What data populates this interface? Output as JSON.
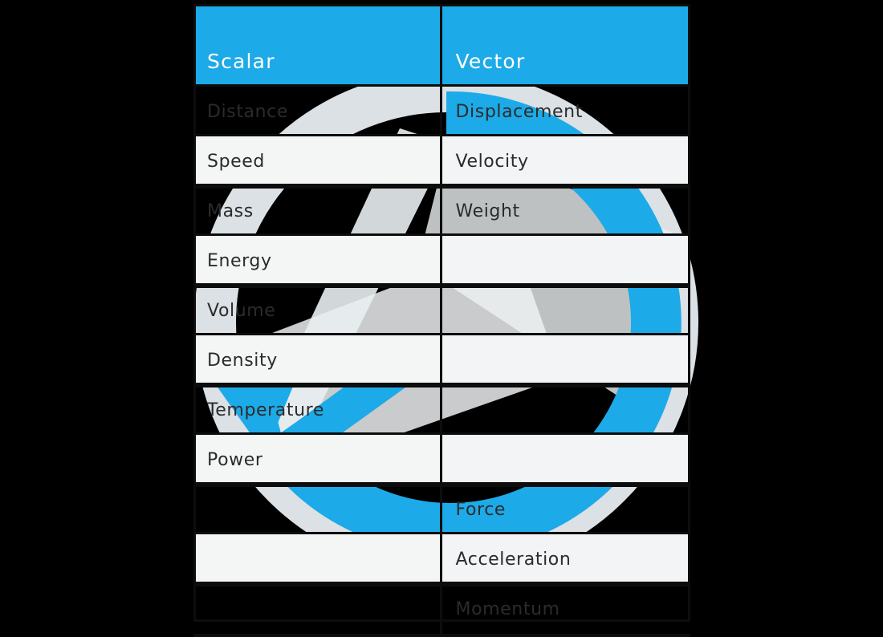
{
  "page": {
    "background_color": "#000000",
    "accent_color": "#1DAAE8",
    "light_row_color": "#f2f4f5",
    "text_color": "#2b2b2b",
    "header_text_color": "#ffffff"
  },
  "watermark": {
    "name": "circular-arrow-check-logo",
    "ring_color": "#1DAAE8",
    "pale_color": "#eef1f3"
  },
  "table": {
    "name": "scalar-vector-comparison-table",
    "columns": [
      {
        "key": "scalar",
        "label": "Scalar"
      },
      {
        "key": "vector",
        "label": "Vector"
      }
    ],
    "rows": [
      {
        "scalar": "Distance",
        "vector": "Displacement",
        "shade": "dark"
      },
      {
        "scalar": "Speed",
        "vector": "Velocity",
        "shade": "light"
      },
      {
        "scalar": "Mass",
        "vector": "Weight",
        "shade": "dark"
      },
      {
        "scalar": "Energy",
        "vector": "",
        "shade": "light"
      },
      {
        "scalar": "Volume",
        "vector": "",
        "shade": "dark"
      },
      {
        "scalar": "Density",
        "vector": "",
        "shade": "light"
      },
      {
        "scalar": "Temperature",
        "vector": "",
        "shade": "dark"
      },
      {
        "scalar": "Power",
        "vector": "",
        "shade": "light"
      },
      {
        "scalar": "",
        "vector": "Force",
        "shade": "dark"
      },
      {
        "scalar": "",
        "vector": "Acceleration",
        "shade": "light"
      },
      {
        "scalar": "",
        "vector": "Momentum",
        "shade": "dark"
      }
    ]
  }
}
